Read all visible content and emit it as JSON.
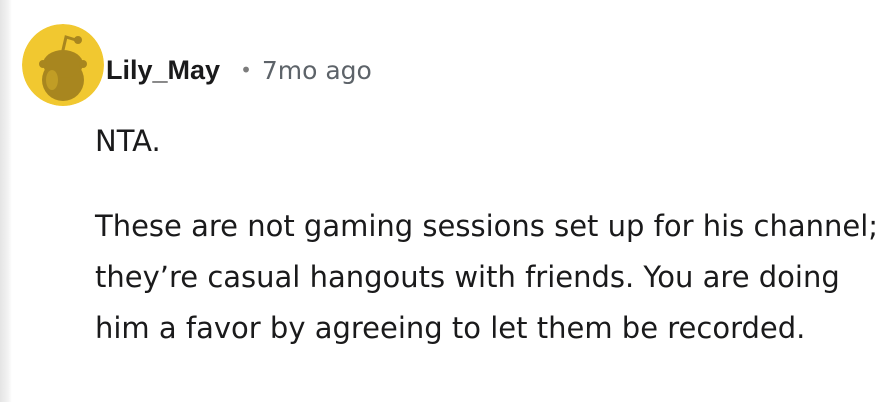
{
  "comment": {
    "avatar_icon": "snoo-avatar-icon",
    "avatar_color": "#f1c830",
    "username": "Lily_May",
    "separator": "•",
    "timestamp": "7mo ago",
    "paragraphs": [
      "NTA.",
      "These are not gaming sessions set up for his channel; they’re casual hangouts with friends. You are doing him a favor by agreeing to let them be recorded."
    ]
  }
}
